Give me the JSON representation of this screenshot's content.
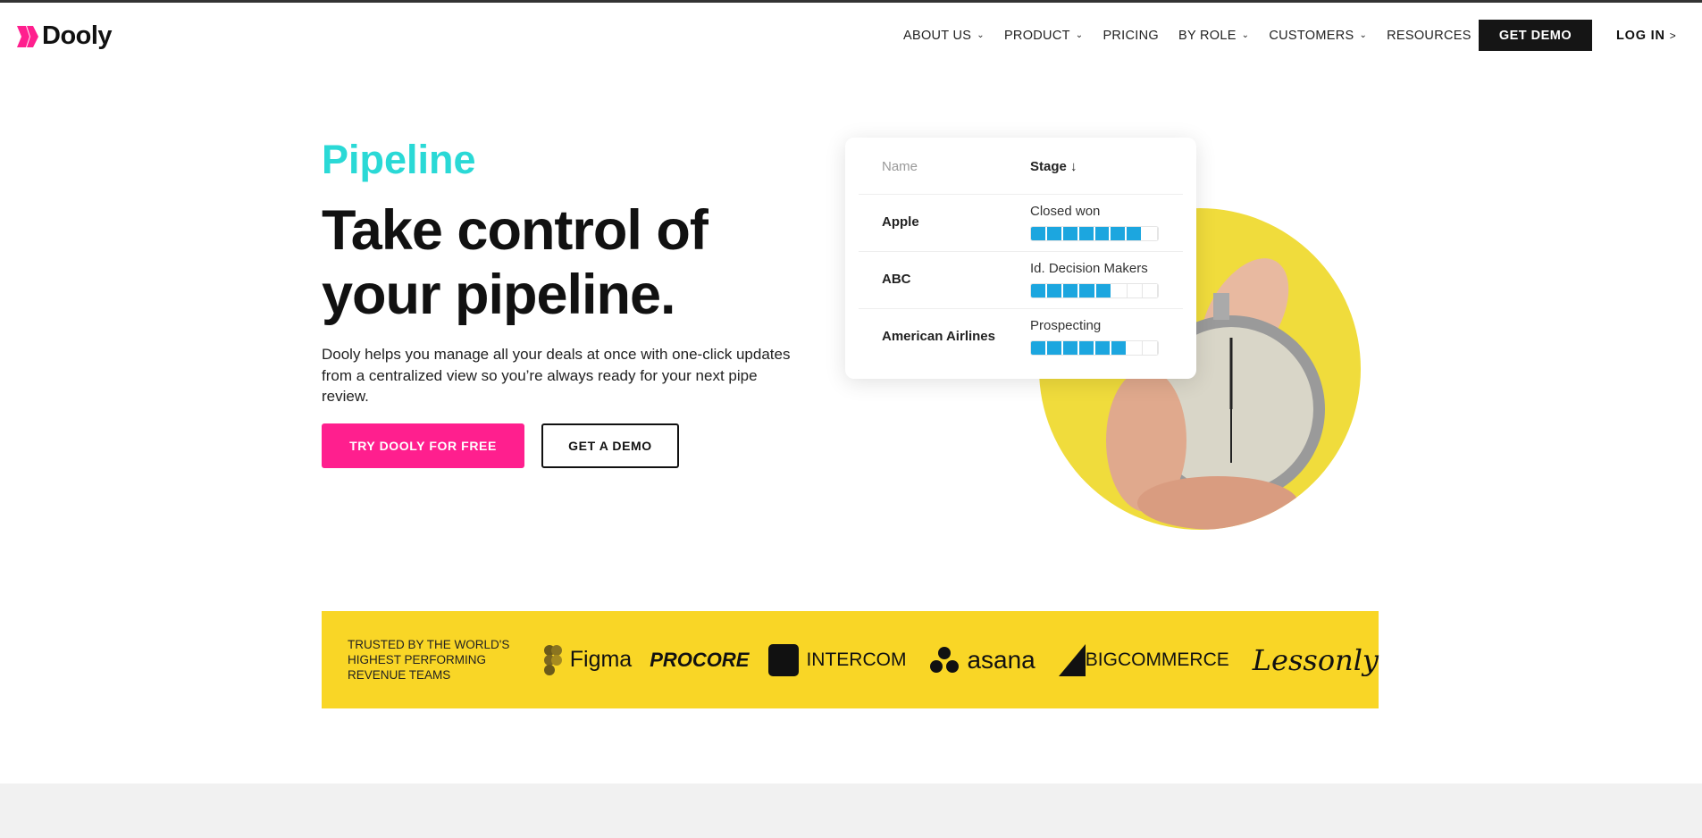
{
  "header": {
    "logo": "Dooly",
    "nav": [
      {
        "label": "ABOUT US",
        "dropdown": true
      },
      {
        "label": "PRODUCT",
        "dropdown": true
      },
      {
        "label": "PRICING",
        "dropdown": false
      },
      {
        "label": "BY ROLE",
        "dropdown": true
      },
      {
        "label": "CUSTOMERS",
        "dropdown": true
      },
      {
        "label": "RESOURCES",
        "dropdown": true
      }
    ],
    "get_demo": "GET DEMO",
    "login": "LOG IN",
    "login_arrow": ">"
  },
  "hero": {
    "kicker": "Pipeline",
    "headline": "Take control of your pipeline.",
    "description": "Dooly helps you manage all your deals at once with one-click updates from a centralized view so you’re always ready for your next pipe review.",
    "primary_cta": "TRY DOOLY FOR FREE",
    "secondary_cta": "GET A DEMO"
  },
  "card": {
    "col_name": "Name",
    "col_stage": "Stage",
    "sort_icon": "↓",
    "rows": [
      {
        "name": "Apple",
        "stage": "Closed won",
        "progress": 7,
        "total": 8
      },
      {
        "name": "ABC",
        "stage": "Id. Decision Makers",
        "progress": 5,
        "total": 8
      },
      {
        "name": "American Airlines",
        "stage": "Prospecting",
        "progress": 6,
        "total": 8
      }
    ]
  },
  "trusted": {
    "text": "TRUSTED BY THE WORLD'S HIGHEST PERFORMING REVENUE TEAMS",
    "logos": [
      "Figma",
      "PROCORE",
      "INTERCOM",
      "asana",
      "BIGCOMMERCE",
      "Lessonly"
    ]
  },
  "colors": {
    "accent_pink": "#ff1f8e",
    "accent_teal": "#2ad9d6",
    "band_yellow": "#f9d626",
    "progress_blue": "#1ca6df"
  }
}
